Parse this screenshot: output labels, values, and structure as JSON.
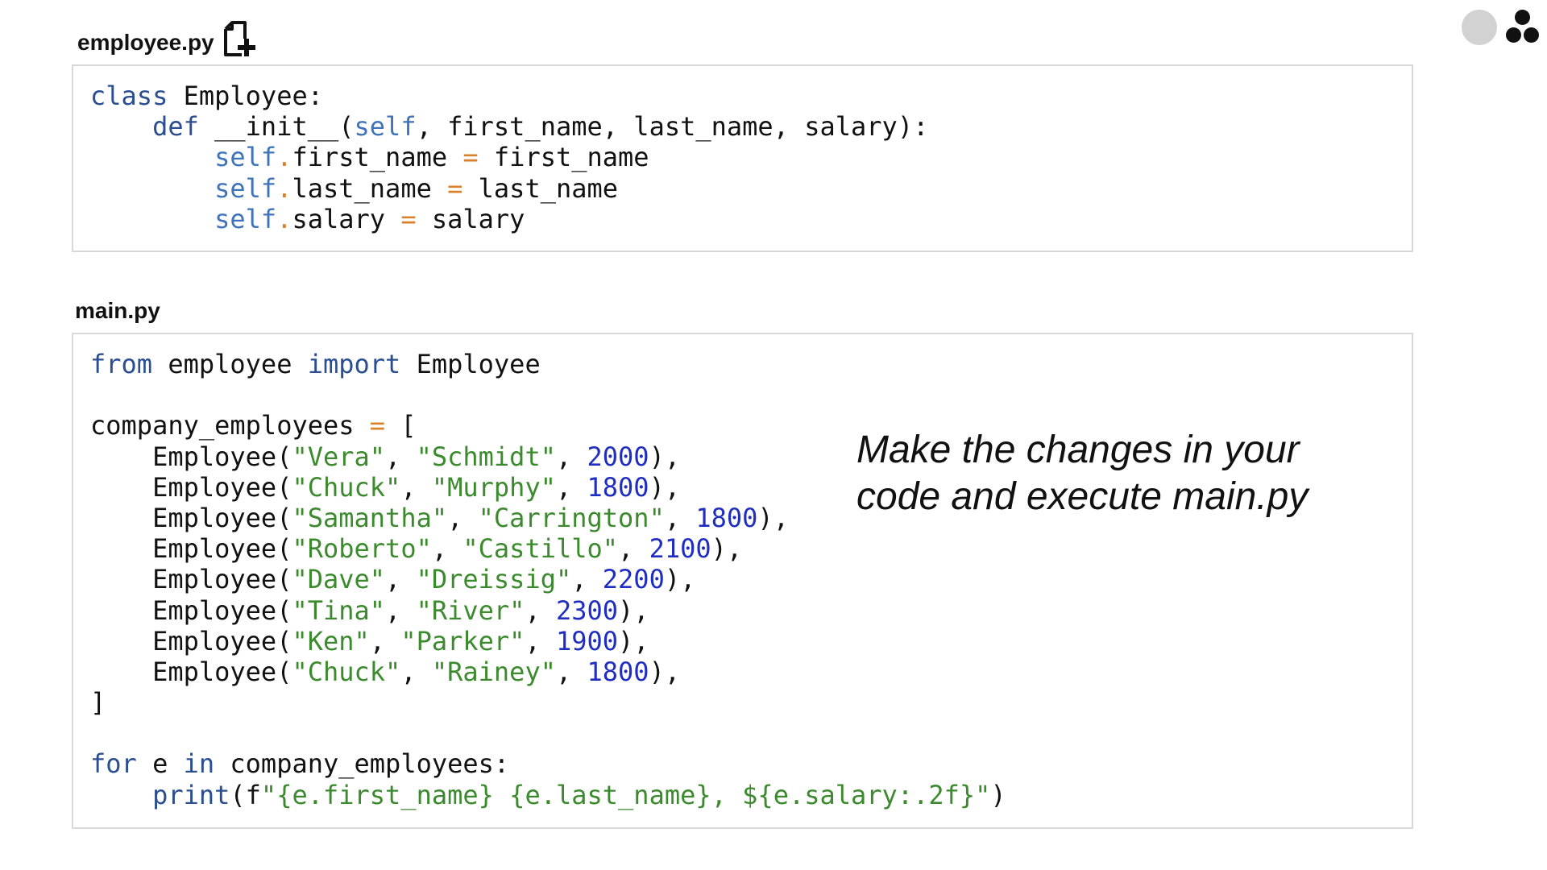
{
  "files": {
    "employee": {
      "title": "employee.py",
      "icon": "new-file-icon",
      "lines": [
        [
          {
            "t": "class",
            "c": "kw"
          },
          {
            "t": " Employee:"
          }
        ],
        [
          {
            "t": "    "
          },
          {
            "t": "def",
            "c": "kw"
          },
          {
            "t": " __init__("
          },
          {
            "t": "self",
            "c": "self"
          },
          {
            "t": ", first_name, last_name, salary):"
          }
        ],
        [
          {
            "t": "        "
          },
          {
            "t": "self",
            "c": "self"
          },
          {
            "t": ".",
            "c": "op"
          },
          {
            "t": "first_name "
          },
          {
            "t": "=",
            "c": "op"
          },
          {
            "t": " first_name"
          }
        ],
        [
          {
            "t": "        "
          },
          {
            "t": "self",
            "c": "self"
          },
          {
            "t": ".",
            "c": "op"
          },
          {
            "t": "last_name "
          },
          {
            "t": "=",
            "c": "op"
          },
          {
            "t": " last_name"
          }
        ],
        [
          {
            "t": "        "
          },
          {
            "t": "self",
            "c": "self"
          },
          {
            "t": ".",
            "c": "op"
          },
          {
            "t": "salary "
          },
          {
            "t": "=",
            "c": "op"
          },
          {
            "t": " salary"
          }
        ]
      ]
    },
    "main": {
      "title": "main.py",
      "lines": [
        [
          {
            "t": "from",
            "c": "kw"
          },
          {
            "t": " employee "
          },
          {
            "t": "import",
            "c": "kw"
          },
          {
            "t": " Employee"
          }
        ],
        [
          {
            "t": ""
          }
        ],
        [
          {
            "t": "company_employees "
          },
          {
            "t": "=",
            "c": "op"
          },
          {
            "t": " ["
          }
        ],
        [
          {
            "t": "    Employee("
          },
          {
            "t": "\"Vera\"",
            "c": "str"
          },
          {
            "t": ", "
          },
          {
            "t": "\"Schmidt\"",
            "c": "str"
          },
          {
            "t": ", "
          },
          {
            "t": "2000",
            "c": "num"
          },
          {
            "t": "),"
          }
        ],
        [
          {
            "t": "    Employee("
          },
          {
            "t": "\"Chuck\"",
            "c": "str"
          },
          {
            "t": ", "
          },
          {
            "t": "\"Murphy\"",
            "c": "str"
          },
          {
            "t": ", "
          },
          {
            "t": "1800",
            "c": "num"
          },
          {
            "t": "),"
          }
        ],
        [
          {
            "t": "    Employee("
          },
          {
            "t": "\"Samantha\"",
            "c": "str"
          },
          {
            "t": ", "
          },
          {
            "t": "\"Carrington\"",
            "c": "str"
          },
          {
            "t": ", "
          },
          {
            "t": "1800",
            "c": "num"
          },
          {
            "t": "),"
          }
        ],
        [
          {
            "t": "    Employee("
          },
          {
            "t": "\"Roberto\"",
            "c": "str"
          },
          {
            "t": ", "
          },
          {
            "t": "\"Castillo\"",
            "c": "str"
          },
          {
            "t": ", "
          },
          {
            "t": "2100",
            "c": "num"
          },
          {
            "t": "),"
          }
        ],
        [
          {
            "t": "    Employee("
          },
          {
            "t": "\"Dave\"",
            "c": "str"
          },
          {
            "t": ", "
          },
          {
            "t": "\"Dreissig\"",
            "c": "str"
          },
          {
            "t": ", "
          },
          {
            "t": "2200",
            "c": "num"
          },
          {
            "t": "),"
          }
        ],
        [
          {
            "t": "    Employee("
          },
          {
            "t": "\"Tina\"",
            "c": "str"
          },
          {
            "t": ", "
          },
          {
            "t": "\"River\"",
            "c": "str"
          },
          {
            "t": ", "
          },
          {
            "t": "2300",
            "c": "num"
          },
          {
            "t": "),"
          }
        ],
        [
          {
            "t": "    Employee("
          },
          {
            "t": "\"Ken\"",
            "c": "str"
          },
          {
            "t": ", "
          },
          {
            "t": "\"Parker\"",
            "c": "str"
          },
          {
            "t": ", "
          },
          {
            "t": "1900",
            "c": "num"
          },
          {
            "t": "),"
          }
        ],
        [
          {
            "t": "    Employee("
          },
          {
            "t": "\"Chuck\"",
            "c": "str"
          },
          {
            "t": ", "
          },
          {
            "t": "\"Rainey\"",
            "c": "str"
          },
          {
            "t": ", "
          },
          {
            "t": "1800",
            "c": "num"
          },
          {
            "t": "),"
          }
        ],
        [
          {
            "t": "]"
          }
        ],
        [
          {
            "t": ""
          }
        ],
        [
          {
            "t": "for",
            "c": "kw"
          },
          {
            "t": " e "
          },
          {
            "t": "in",
            "c": "kw"
          },
          {
            "t": " company_employees:"
          }
        ],
        [
          {
            "t": "    "
          },
          {
            "t": "print",
            "c": "fn"
          },
          {
            "t": "(f"
          },
          {
            "t": "\"{e.first_name} {e.last_name}, ${e.salary:.2f}\"",
            "c": "str"
          },
          {
            "t": ")"
          }
        ]
      ]
    }
  },
  "instruction": "Make the changes in your code and execute main.py",
  "logo": {
    "name": "three-dot-logo",
    "colors": {
      "gray": "#d2d2d2",
      "black": "#111111"
    }
  },
  "syntax_colors": {
    "keyword": "#2a4e8f",
    "self": "#3f73ba",
    "operator": "#d9822b",
    "string": "#3c8a2e",
    "number": "#1f2ec0"
  }
}
